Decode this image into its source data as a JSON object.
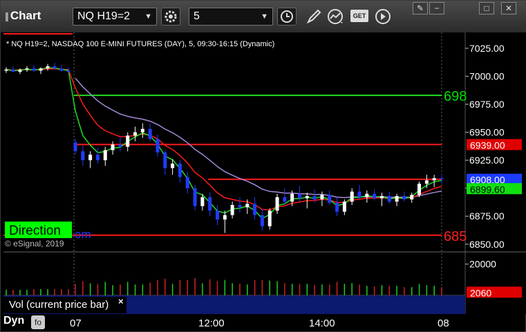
{
  "toolbar": {
    "app_title": "Chart",
    "symbol": "NQ H19=2",
    "interval": "5",
    "icons": [
      "gear-icon",
      "clock-icon",
      "pencil-icon",
      "study-icon",
      "get-icon",
      "play-icon"
    ],
    "get_label": "GET",
    "window_controls": [
      "✎",
      "−",
      "□",
      "✕"
    ]
  },
  "chart": {
    "header": "* NQ H19=2, NASDAQ 100 E-MINI FUTURES (DAY), 5, 09:30-16:15 (Dynamic)",
    "watermark": "© eSignal, 2019",
    "direction_label": "Direction",
    "direction_suffix": "om",
    "price_ticks": [
      "7025.00",
      "7000.00",
      "6975.00",
      "6950.00",
      "6925.00",
      "6900.00",
      "6875.00",
      "6850.00"
    ],
    "level_labels": [
      {
        "text": "698",
        "color": "#00e000"
      },
      {
        "text": "685",
        "color": "#ff2020"
      }
    ],
    "price_tags": [
      {
        "text": "6939.00",
        "value": 6939.0,
        "bg": "#e00000",
        "fg": "#ffffff"
      },
      {
        "text": "6908.00",
        "value": 6908.0,
        "bg": "#1c3cff",
        "fg": "#ffffff"
      },
      {
        "text": "6899.60",
        "value": 6899.6,
        "bg": "#10e010",
        "fg": "#000000"
      }
    ],
    "colors": {
      "up": "#ffffff",
      "down": "#1f3cff",
      "red": "#ff1a1a",
      "green": "#22dd22",
      "purple": "#a58ad6"
    }
  },
  "volume": {
    "label": "Vol (current price bar)",
    "close_symbol": "×",
    "ticks": [
      "20000"
    ],
    "tag": "2060"
  },
  "footer": {
    "dyn": "Dyn",
    "dyn_icon": "fo",
    "x_ticks": [
      "07",
      "12:00",
      "14:00",
      "08"
    ]
  },
  "chart_data": {
    "type": "candlestick",
    "header": "* NQ H19=2, NASDAQ 100 E-MINI FUTURES (DAY), 5, 09:30-16:15 (Dynamic)",
    "y_ticks": [
      7025,
      7000,
      6975,
      6950,
      6925,
      6900,
      6875,
      6850
    ],
    "ylim": [
      6848,
      7033
    ],
    "x_tick_labels": [
      "07",
      "12:00",
      "14:00",
      "08"
    ],
    "horizontal_levels": [
      {
        "value": 6983,
        "color": "green",
        "label": "698"
      },
      {
        "value": 6939,
        "color": "red"
      },
      {
        "value": 6908,
        "color": "red"
      },
      {
        "value": 6858,
        "color": "red",
        "label": "685"
      }
    ],
    "candles": [
      [
        7005,
        7008,
        7003,
        7006
      ],
      [
        7006,
        7009,
        7004,
        7004
      ],
      [
        7004,
        7007,
        7002,
        7006
      ],
      [
        7006,
        7009,
        7004,
        7007
      ],
      [
        7007,
        7010,
        7004,
        7005
      ],
      [
        7005,
        7008,
        7002,
        7007
      ],
      [
        7007,
        7011,
        7005,
        7009
      ],
      [
        7009,
        7012,
        7006,
        7007
      ],
      [
        7007,
        7010,
        7004,
        7005
      ],
      [
        7005,
        7008,
        7002,
        7004
      ],
      [
        6941,
        6944,
        6930,
        6933
      ],
      [
        6933,
        6938,
        6920,
        6925
      ],
      [
        6925,
        6933,
        6918,
        6930
      ],
      [
        6930,
        6936,
        6922,
        6925
      ],
      [
        6925,
        6937,
        6920,
        6934
      ],
      [
        6934,
        6942,
        6930,
        6939
      ],
      [
        6939,
        6946,
        6933,
        6937
      ],
      [
        6937,
        6950,
        6933,
        6947
      ],
      [
        6947,
        6955,
        6942,
        6950
      ],
      [
        6950,
        6958,
        6945,
        6953
      ],
      [
        6953,
        6958,
        6942,
        6944
      ],
      [
        6944,
        6948,
        6928,
        6932
      ],
      [
        6932,
        6934,
        6912,
        6918
      ],
      [
        6918,
        6926,
        6912,
        6922
      ],
      [
        6922,
        6925,
        6905,
        6910
      ],
      [
        6910,
        6915,
        6895,
        6900
      ],
      [
        6900,
        6903,
        6880,
        6884
      ],
      [
        6884,
        6895,
        6880,
        6892
      ],
      [
        6892,
        6896,
        6875,
        6880
      ],
      [
        6880,
        6885,
        6867,
        6872
      ],
      [
        6872,
        6880,
        6860,
        6876
      ],
      [
        6876,
        6888,
        6873,
        6885
      ],
      [
        6885,
        6892,
        6878,
        6883
      ],
      [
        6883,
        6890,
        6877,
        6886
      ],
      [
        6886,
        6892,
        6872,
        6876
      ],
      [
        6876,
        6882,
        6862,
        6866
      ],
      [
        6866,
        6882,
        6863,
        6880
      ],
      [
        6880,
        6895,
        6877,
        6892
      ],
      [
        6892,
        6900,
        6885,
        6888
      ],
      [
        6888,
        6898,
        6884,
        6895
      ],
      [
        6895,
        6902,
        6888,
        6891
      ],
      [
        6891,
        6896,
        6882,
        6893
      ],
      [
        6893,
        6899,
        6887,
        6890
      ],
      [
        6890,
        6897,
        6884,
        6894
      ],
      [
        6894,
        6898,
        6885,
        6887
      ],
      [
        6887,
        6892,
        6875,
        6879
      ],
      [
        6879,
        6890,
        6876,
        6888
      ],
      [
        6888,
        6900,
        6885,
        6897
      ],
      [
        6897,
        6903,
        6890,
        6892
      ],
      [
        6892,
        6898,
        6887,
        6895
      ],
      [
        6895,
        6899,
        6889,
        6891
      ],
      [
        6891,
        6896,
        6884,
        6893
      ],
      [
        6893,
        6897,
        6886,
        6888
      ],
      [
        6888,
        6895,
        6884,
        6893
      ],
      [
        6893,
        6897,
        6888,
        6890
      ],
      [
        6890,
        6896,
        6887,
        6894
      ],
      [
        6894,
        6906,
        6892,
        6904
      ],
      [
        6904,
        6912,
        6900,
        6907
      ],
      [
        6907,
        6912,
        6901,
        6909
      ],
      [
        6909,
        6913,
        6904,
        6908
      ]
    ],
    "volume": {
      "ylim": [
        0,
        26000
      ],
      "tick": 20000,
      "last_value": 2060
    }
  }
}
